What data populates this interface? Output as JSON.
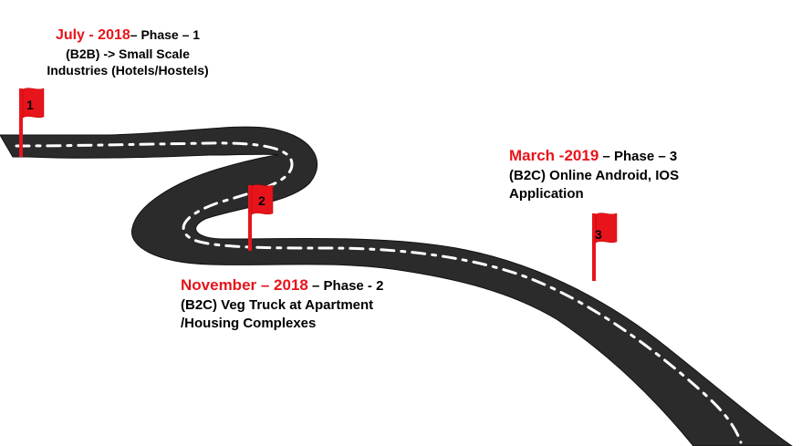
{
  "phases": [
    {
      "flag_number": "1",
      "date": "July - 2018",
      "phase": "– Phase – 1",
      "lines": [
        "(B2B) -> Small Scale",
        "Industries (Hotels/Hostels)"
      ]
    },
    {
      "flag_number": "2",
      "date": "November – 2018",
      "phase": "– Phase - 2",
      "lines": [
        "(B2C) Veg Truck at Apartment",
        "/Housing Complexes"
      ]
    },
    {
      "flag_number": "3",
      "date": "March -2019",
      "phase": "– Phase – 3",
      "lines": [
        "(B2C) Online Android, IOS",
        "Application"
      ]
    }
  ],
  "colors": {
    "road": "#2b2b2b",
    "road_edge": "#111111",
    "dash": "#ffffff",
    "flag": "#e8141b",
    "date_text": "#e8141b",
    "body_text": "#000000"
  }
}
